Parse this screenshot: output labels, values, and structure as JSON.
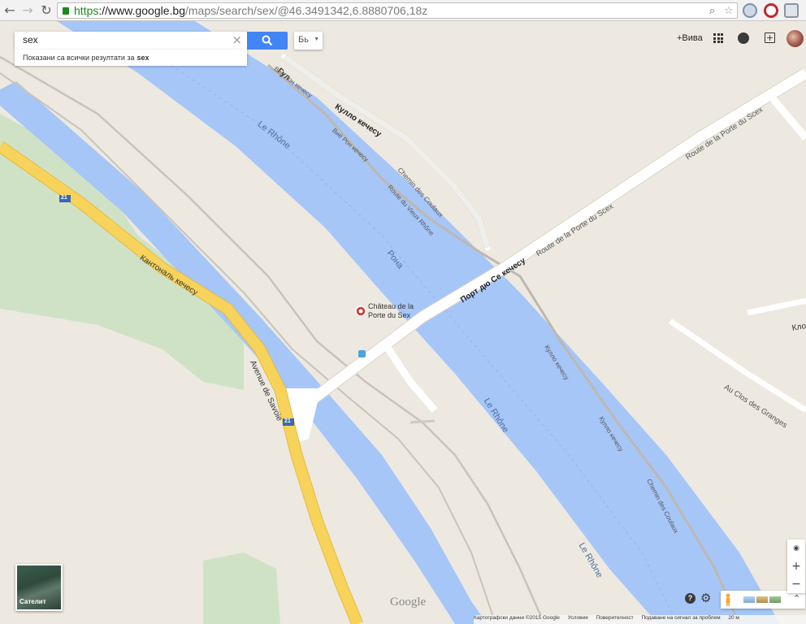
{
  "browser": {
    "url_scheme": "https",
    "url_host": "://www.google.bg",
    "url_path": "/maps/search/sex/@46.3491342,6.8880706,18z"
  },
  "search": {
    "query": "sex",
    "results_prefix": "Показани са всички резултати за",
    "results_query": "sex",
    "language_button": "Бь"
  },
  "header": {
    "plus_you": "+Вива"
  },
  "map": {
    "poi": {
      "name_line1": "Château de la",
      "name_line2": "Porte du Sex"
    },
    "labels": {
      "route_cantonale": "Кантональ кечесу",
      "avenue_savoie": "Avenue de Savoie",
      "route_21a": "21",
      "route_21b": "21",
      "le_rhone_1": "Le Rhône",
      "le_rhone_2": "Le Rhône",
      "le_rhone_3": "Le Rhône",
      "rona": "Рона",
      "port_du_sex_bg": "Порт дю Се кечесу",
      "route_porte_sex_1": "Route de la Porte du Scex",
      "route_porte_sex_2": "Route de la Porte du Scex",
      "kullo_1": "Кулло кечесу",
      "kullo_2": "Кулло кечесу",
      "kullo_3": "Кулло кечесу",
      "vieux_rhone_bg": "Виё Рон кечесу",
      "route_vieux_rhone": "Route du Vieux Rhône",
      "chemin_coulaux_1": "Chemin des Coulaux",
      "chemin_coulaux_2": "Chemin des Coulaux",
      "au_clos_granges": "Au Clos des Granges",
      "klo_partial": "Кло",
      "top_partial": "Гул",
      "top_partial_2": "Виё Рон кечесу"
    },
    "satellite_label": "Сателит",
    "google_logo": "Google",
    "footer": {
      "attribution": "Картографски данни ©2015 Google",
      "terms": "Условия",
      "privacy": "Поверителност",
      "report": "Подаване на сигнал за проблем",
      "scale": "20 м"
    },
    "zoom": {
      "in": "+",
      "out": "−"
    },
    "colors": {
      "water": "#a6c6f8",
      "land": "#ede9e0",
      "park": "#cfe2c6",
      "highway": "#f7d35b",
      "road": "#ffffff",
      "accent": "#4285f4"
    }
  }
}
